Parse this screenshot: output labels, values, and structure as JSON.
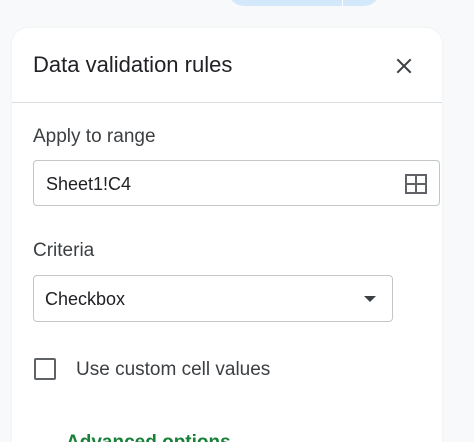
{
  "panel": {
    "title": "Data validation rules",
    "close_icon": "close-icon"
  },
  "range": {
    "label": "Apply to range",
    "value": "Sheet1!C4",
    "icon": "grid-select-icon"
  },
  "criteria": {
    "label": "Criteria",
    "selected": "Checkbox",
    "icon": "dropdown-arrow-icon"
  },
  "custom_values": {
    "label": "Use custom cell values",
    "checked": false
  },
  "advanced": {
    "label": "Advanced options"
  },
  "colors": {
    "accent_green": "#188038",
    "border": "#c4c7c5",
    "chip": "#d3e9fb"
  }
}
